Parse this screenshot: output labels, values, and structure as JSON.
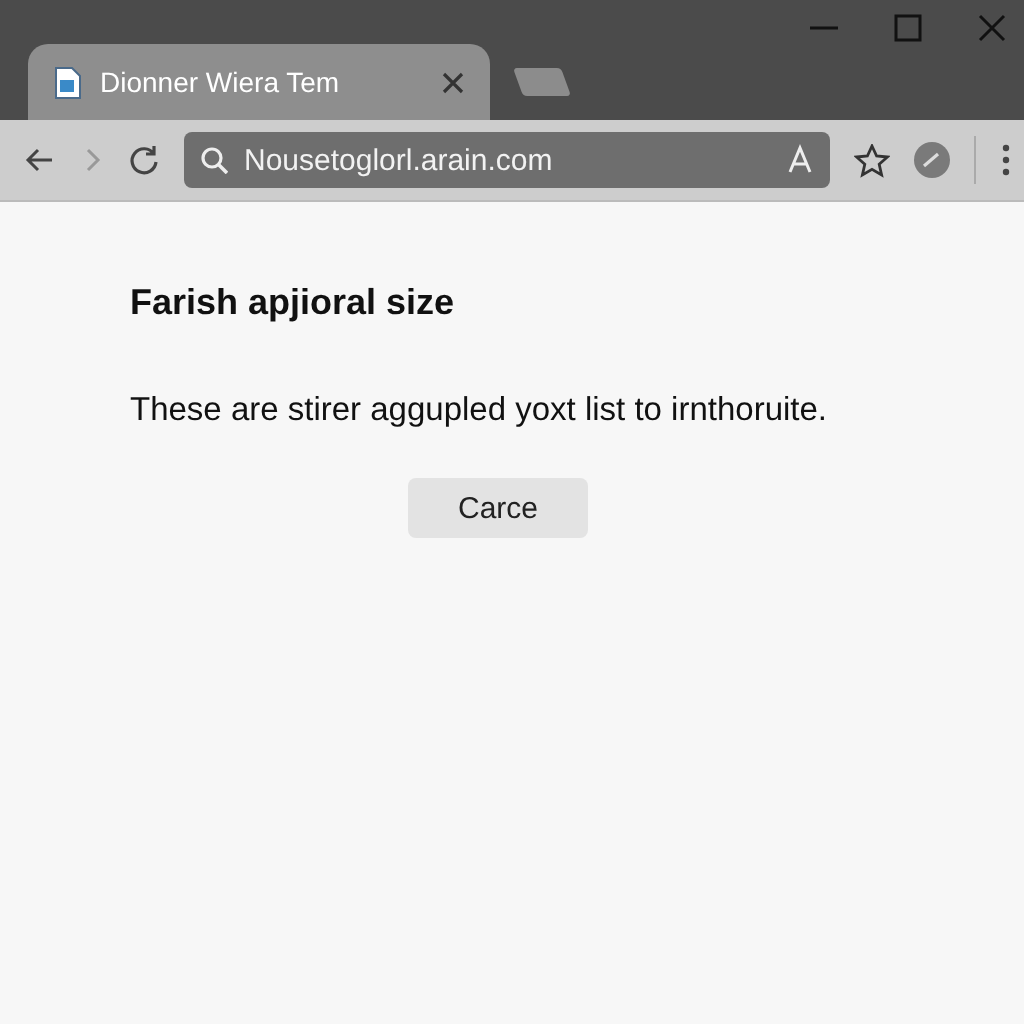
{
  "tabs": [
    {
      "title": "Dionner Wiera Tem",
      "selected": true
    }
  ],
  "address": {
    "value": "Nousetoglorl.arain.com"
  },
  "dialog": {
    "heading": "Farish apjioral size",
    "message": "These are stirer aggupled yoxt list to irnthoruite.",
    "button": "Carce"
  }
}
